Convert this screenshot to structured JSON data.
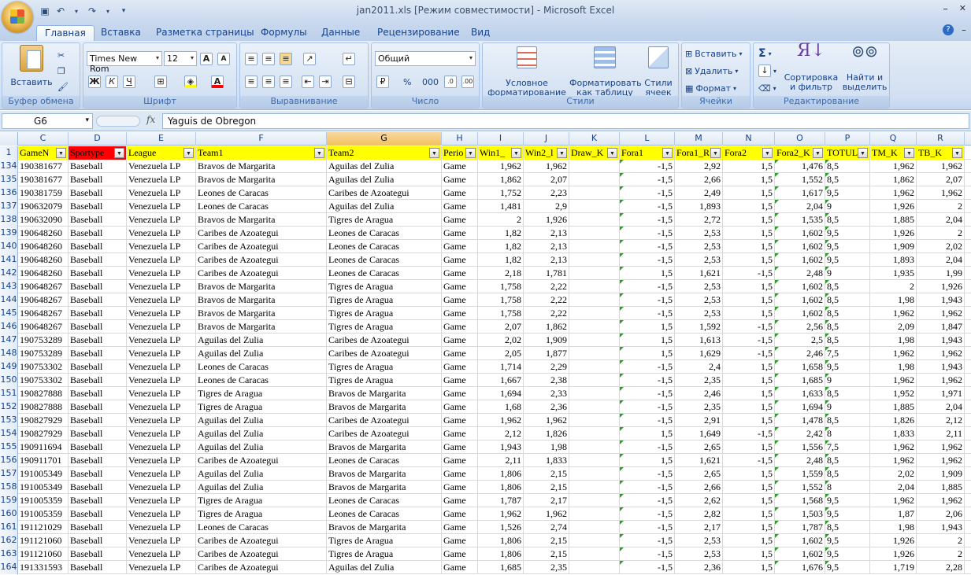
{
  "window": {
    "title": "jan2011.xls  [Режим совместимости] - Microsoft Excel",
    "minimize": "–",
    "close": "✕"
  },
  "ribbon_tabs": [
    "Главная",
    "Вставка",
    "Разметка страницы",
    "Формулы",
    "Данные",
    "Рецензирование",
    "Вид"
  ],
  "clipboard": {
    "paste": "Вставить",
    "label": "Буфер обмена"
  },
  "font": {
    "name": "Times New Rom",
    "size": "12",
    "label": "Шрифт",
    "bold": "Ж",
    "italic": "К",
    "underline": "Ч"
  },
  "alignment": {
    "label": "Выравнивание"
  },
  "number": {
    "format": "Общий",
    "label": "Число",
    "percent": "%",
    "thousands": "000"
  },
  "styles": {
    "conditional_1": "Условное",
    "conditional_2": "форматирование",
    "table_1": "Форматировать",
    "table_2": "как таблицу",
    "cell_1": "Стили",
    "cell_2": "ячеек",
    "label": "Стили"
  },
  "cells": {
    "insert": "Вставить",
    "delete": "Удалить",
    "format": "Формат",
    "label": "Ячейки"
  },
  "editing": {
    "sort_1": "Сортировка",
    "sort_2": "и фильтр",
    "find_1": "Найти и",
    "find_2": "выделить",
    "label": "Редактирование"
  },
  "formula_bar": {
    "name_box": "G6",
    "fx": "fx",
    "content": "Yaguis de Obregon"
  },
  "columns": [
    "C",
    "D",
    "E",
    "F",
    "G",
    "H",
    "I",
    "J",
    "K",
    "L",
    "M",
    "N",
    "O",
    "P",
    "Q",
    "R"
  ],
  "selected_column": "G",
  "header_row": {
    "num": "1",
    "cells": [
      "GameN",
      "Sportype",
      "League",
      "Team1",
      "Team2",
      "Perio",
      "Win1_",
      "Win2_l",
      "Draw_K",
      "Fora1",
      "Fora1_R",
      "Fora2",
      "Fora2_K",
      "TOTUL",
      "TM_K",
      "TB_K"
    ]
  },
  "rows": [
    [
      "134",
      "190381677",
      "Baseball",
      "Venezuela LP",
      "Bravos de Margarita",
      "Aguilas del Zulia",
      "Game",
      "1,962",
      "1,962",
      "",
      "-1,5",
      "2,92",
      "1,5",
      "1,476",
      "8,5",
      "1,962",
      "1,962"
    ],
    [
      "135",
      "190381677",
      "Baseball",
      "Venezuela LP",
      "Bravos de Margarita",
      "Aguilas del Zulia",
      "Game",
      "1,862",
      "2,07",
      "",
      "-1,5",
      "2,66",
      "1,5",
      "1,552",
      "8,5",
      "1,862",
      "2,07"
    ],
    [
      "136",
      "190381759",
      "Baseball",
      "Venezuela LP",
      "Leones de Caracas",
      "Caribes de Azoategui",
      "Game",
      "1,752",
      "2,23",
      "",
      "-1,5",
      "2,49",
      "1,5",
      "1,617",
      "9,5",
      "1,962",
      "1,962"
    ],
    [
      "137",
      "190632079",
      "Baseball",
      "Venezuela LP",
      "Leones de Caracas",
      "Aguilas del Zulia",
      "Game",
      "1,481",
      "2,9",
      "",
      "-1,5",
      "1,893",
      "1,5",
      "2,04",
      "9",
      "1,926",
      "2"
    ],
    [
      "138",
      "190632090",
      "Baseball",
      "Venezuela LP",
      "Bravos de Margarita",
      "Tigres de Aragua",
      "Game",
      "2",
      "1,926",
      "",
      "-1,5",
      "2,72",
      "1,5",
      "1,535",
      "8,5",
      "1,885",
      "2,04"
    ],
    [
      "139",
      "190648260",
      "Baseball",
      "Venezuela LP",
      "Caribes de Azoategui",
      "Leones de Caracas",
      "Game",
      "1,82",
      "2,13",
      "",
      "-1,5",
      "2,53",
      "1,5",
      "1,602",
      "9,5",
      "1,926",
      "2"
    ],
    [
      "140",
      "190648260",
      "Baseball",
      "Venezuela LP",
      "Caribes de Azoategui",
      "Leones de Caracas",
      "Game",
      "1,82",
      "2,13",
      "",
      "-1,5",
      "2,53",
      "1,5",
      "1,602",
      "9,5",
      "1,909",
      "2,02"
    ],
    [
      "141",
      "190648260",
      "Baseball",
      "Venezuela LP",
      "Caribes de Azoategui",
      "Leones de Caracas",
      "Game",
      "1,82",
      "2,13",
      "",
      "-1,5",
      "2,53",
      "1,5",
      "1,602",
      "9,5",
      "1,893",
      "2,04"
    ],
    [
      "142",
      "190648260",
      "Baseball",
      "Venezuela LP",
      "Caribes de Azoategui",
      "Leones de Caracas",
      "Game",
      "2,18",
      "1,781",
      "",
      "1,5",
      "1,621",
      "-1,5",
      "2,48",
      "9",
      "1,935",
      "1,99"
    ],
    [
      "143",
      "190648267",
      "Baseball",
      "Venezuela LP",
      "Bravos de Margarita",
      "Tigres de Aragua",
      "Game",
      "1,758",
      "2,22",
      "",
      "-1,5",
      "2,53",
      "1,5",
      "1,602",
      "8,5",
      "2",
      "1,926"
    ],
    [
      "144",
      "190648267",
      "Baseball",
      "Venezuela LP",
      "Bravos de Margarita",
      "Tigres de Aragua",
      "Game",
      "1,758",
      "2,22",
      "",
      "-1,5",
      "2,53",
      "1,5",
      "1,602",
      "8,5",
      "1,98",
      "1,943"
    ],
    [
      "145",
      "190648267",
      "Baseball",
      "Venezuela LP",
      "Bravos de Margarita",
      "Tigres de Aragua",
      "Game",
      "1,758",
      "2,22",
      "",
      "-1,5",
      "2,53",
      "1,5",
      "1,602",
      "8,5",
      "1,962",
      "1,962"
    ],
    [
      "146",
      "190648267",
      "Baseball",
      "Venezuela LP",
      "Bravos de Margarita",
      "Tigres de Aragua",
      "Game",
      "2,07",
      "1,862",
      "",
      "1,5",
      "1,592",
      "-1,5",
      "2,56",
      "8,5",
      "2,09",
      "1,847"
    ],
    [
      "147",
      "190753289",
      "Baseball",
      "Venezuela LP",
      "Aguilas del Zulia",
      "Caribes de Azoategui",
      "Game",
      "2,02",
      "1,909",
      "",
      "1,5",
      "1,613",
      "-1,5",
      "2,5",
      "8,5",
      "1,98",
      "1,943"
    ],
    [
      "148",
      "190753289",
      "Baseball",
      "Venezuela LP",
      "Aguilas del Zulia",
      "Caribes de Azoategui",
      "Game",
      "2,05",
      "1,877",
      "",
      "1,5",
      "1,629",
      "-1,5",
      "2,46",
      "7,5",
      "1,962",
      "1,962"
    ],
    [
      "149",
      "190753302",
      "Baseball",
      "Venezuela LP",
      "Leones de Caracas",
      "Tigres de Aragua",
      "Game",
      "1,714",
      "2,29",
      "",
      "-1,5",
      "2,4",
      "1,5",
      "1,658",
      "9,5",
      "1,98",
      "1,943"
    ],
    [
      "150",
      "190753302",
      "Baseball",
      "Venezuela LP",
      "Leones de Caracas",
      "Tigres de Aragua",
      "Game",
      "1,667",
      "2,38",
      "",
      "-1,5",
      "2,35",
      "1,5",
      "1,685",
      "9",
      "1,962",
      "1,962"
    ],
    [
      "151",
      "190827888",
      "Baseball",
      "Venezuela LP",
      "Tigres de Aragua",
      "Bravos de Margarita",
      "Game",
      "1,694",
      "2,33",
      "",
      "-1,5",
      "2,46",
      "1,5",
      "1,633",
      "8,5",
      "1,952",
      "1,971"
    ],
    [
      "152",
      "190827888",
      "Baseball",
      "Venezuela LP",
      "Tigres de Aragua",
      "Bravos de Margarita",
      "Game",
      "1,68",
      "2,36",
      "",
      "-1,5",
      "2,35",
      "1,5",
      "1,694",
      "9",
      "1,885",
      "2,04"
    ],
    [
      "153",
      "190827929",
      "Baseball",
      "Venezuela LP",
      "Aguilas del Zulia",
      "Caribes de Azoategui",
      "Game",
      "1,962",
      "1,962",
      "",
      "-1,5",
      "2,91",
      "1,5",
      "1,478",
      "8,5",
      "1,826",
      "2,12"
    ],
    [
      "154",
      "190827929",
      "Baseball",
      "Venezuela LP",
      "Aguilas del Zulia",
      "Caribes de Azoategui",
      "Game",
      "2,12",
      "1,826",
      "",
      "1,5",
      "1,649",
      "-1,5",
      "2,42",
      "8",
      "1,833",
      "2,11"
    ],
    [
      "155",
      "190911694",
      "Baseball",
      "Venezuela LP",
      "Aguilas del Zulia",
      "Bravos de Margarita",
      "Game",
      "1,943",
      "1,98",
      "",
      "-1,5",
      "2,65",
      "1,5",
      "1,556",
      "7,5",
      "1,962",
      "1,962"
    ],
    [
      "156",
      "190911701",
      "Baseball",
      "Venezuela LP",
      "Caribes de Azoategui",
      "Leones de Caracas",
      "Game",
      "2,11",
      "1,833",
      "",
      "1,5",
      "1,621",
      "-1,5",
      "2,48",
      "8,5",
      "1,962",
      "1,962"
    ],
    [
      "157",
      "191005349",
      "Baseball",
      "Venezuela LP",
      "Aguilas del Zulia",
      "Bravos de Margarita",
      "Game",
      "1,806",
      "2,15",
      "",
      "-1,5",
      "2,65",
      "1,5",
      "1,559",
      "8,5",
      "2,02",
      "1,909"
    ],
    [
      "158",
      "191005349",
      "Baseball",
      "Venezuela LP",
      "Aguilas del Zulia",
      "Bravos de Margarita",
      "Game",
      "1,806",
      "2,15",
      "",
      "-1,5",
      "2,66",
      "1,5",
      "1,552",
      "8",
      "2,04",
      "1,885"
    ],
    [
      "159",
      "191005359",
      "Baseball",
      "Venezuela LP",
      "Tigres de Aragua",
      "Leones de Caracas",
      "Game",
      "1,787",
      "2,17",
      "",
      "-1,5",
      "2,62",
      "1,5",
      "1,568",
      "9,5",
      "1,962",
      "1,962"
    ],
    [
      "160",
      "191005359",
      "Baseball",
      "Venezuela LP",
      "Tigres de Aragua",
      "Leones de Caracas",
      "Game",
      "1,962",
      "1,962",
      "",
      "-1,5",
      "2,82",
      "1,5",
      "1,503",
      "9,5",
      "1,87",
      "2,06"
    ],
    [
      "161",
      "191121029",
      "Baseball",
      "Venezuela LP",
      "Leones de Caracas",
      "Bravos de Margarita",
      "Game",
      "1,526",
      "2,74",
      "",
      "-1,5",
      "2,17",
      "1,5",
      "1,787",
      "8,5",
      "1,98",
      "1,943"
    ],
    [
      "162",
      "191121060",
      "Baseball",
      "Venezuela LP",
      "Caribes de Azoategui",
      "Tigres de Aragua",
      "Game",
      "1,806",
      "2,15",
      "",
      "-1,5",
      "2,53",
      "1,5",
      "1,602",
      "9,5",
      "1,926",
      "2"
    ],
    [
      "163",
      "191121060",
      "Baseball",
      "Venezuela LP",
      "Caribes de Azoategui",
      "Tigres de Aragua",
      "Game",
      "1,806",
      "2,15",
      "",
      "-1,5",
      "2,53",
      "1,5",
      "1,602",
      "9,5",
      "1,926",
      "2"
    ],
    [
      "164",
      "191331593",
      "Baseball",
      "Venezuela LP",
      "Caribes de Azoategui",
      "Aguilas del Zulia",
      "Game",
      "1,685",
      "2,35",
      "",
      "-1,5",
      "2,36",
      "1,5",
      "1,676",
      "9,5",
      "1,719",
      "2,28"
    ]
  ]
}
